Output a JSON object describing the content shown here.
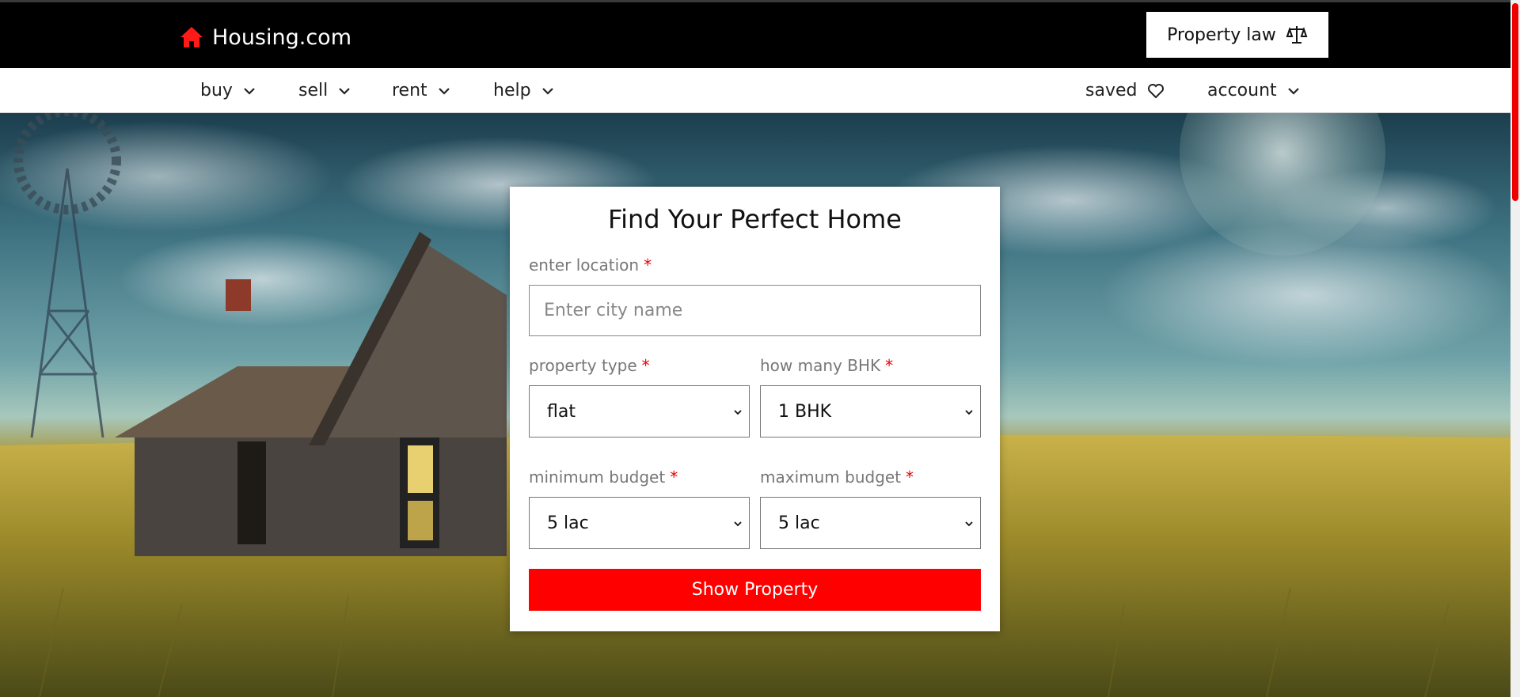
{
  "header": {
    "brand": "Housing.com",
    "property_law": "Property law"
  },
  "nav": {
    "left": [
      {
        "label": "buy"
      },
      {
        "label": "sell"
      },
      {
        "label": "rent"
      },
      {
        "label": "help"
      }
    ],
    "saved": "saved",
    "account": "account"
  },
  "form": {
    "title": "Find Your Perfect Home",
    "location_label": "enter location",
    "location_placeholder": "Enter city name",
    "property_type_label": "property type",
    "property_type_value": "flat",
    "bhk_label": "how many BHK",
    "bhk_value": "1 BHK",
    "min_budget_label": "minimum budget",
    "min_budget_value": "5 lac",
    "max_budget_label": "maximum budget",
    "max_budget_value": "5 lac",
    "required_mark": "*",
    "submit_label": "Show Property"
  },
  "colors": {
    "accent": "#ff0000",
    "header_bg": "#000000"
  },
  "icons": {
    "logo": "house-icon",
    "property_law": "scales-icon",
    "saved": "heart-icon",
    "dropdown": "chevron-down-icon"
  }
}
